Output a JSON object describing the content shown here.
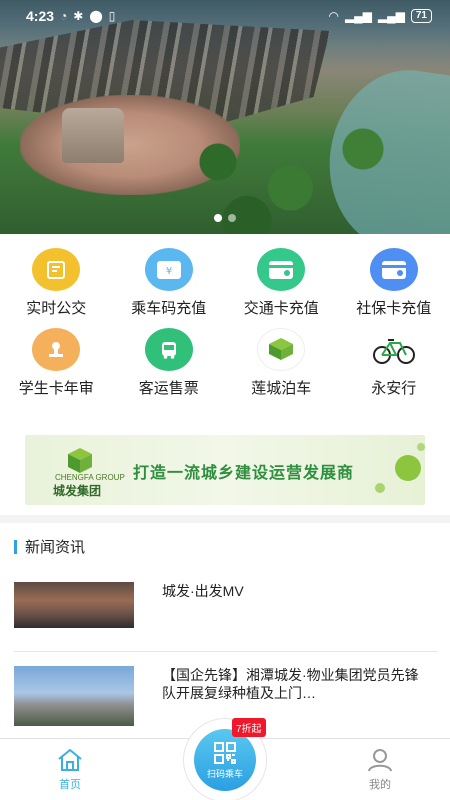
{
  "status_bar": {
    "time": "4:23",
    "battery": "71"
  },
  "banner": {
    "dots": 2,
    "active_index": 0
  },
  "grid": [
    {
      "label": "实时公交",
      "icon": "bus-map-icon",
      "color": "#f4c12e"
    },
    {
      "label": "乘车码充值",
      "icon": "yen-card-icon",
      "color": "#5ab7ef"
    },
    {
      "label": "交通卡充值",
      "icon": "card-icon",
      "color": "#34c88b"
    },
    {
      "label": "社保卡充值",
      "icon": "social-card-icon",
      "color": "#4f8ef2"
    },
    {
      "label": "学生卡年审",
      "icon": "stamp-icon",
      "color": "#f4b05a"
    },
    {
      "label": "客运售票",
      "icon": "coach-icon",
      "color": "#30c07a"
    },
    {
      "label": "莲城泊车",
      "icon": "parking-logo-icon",
      "color": "#ffffff"
    },
    {
      "label": "永安行",
      "icon": "bicycle-icon",
      "color": "#ffffff"
    }
  ],
  "ad": {
    "logo_sub": "CHENGFA GROUP",
    "logo_name": "城发集团",
    "slogan": "打造一流城乡建设运营发展商"
  },
  "news": {
    "section_title": "新闻资讯",
    "items": [
      {
        "title": "城发·出发MV"
      },
      {
        "title": "【国企先锋】湘潭城发·物业集团党员先锋队开展复绿种植及上门…"
      }
    ]
  },
  "bottom_nav": {
    "home": "首页",
    "scan": "扫码乘车",
    "scan_badge": "7折起",
    "mine": "我的"
  },
  "colors": {
    "accent": "#2f9fe8",
    "badge": "#f0182b"
  }
}
